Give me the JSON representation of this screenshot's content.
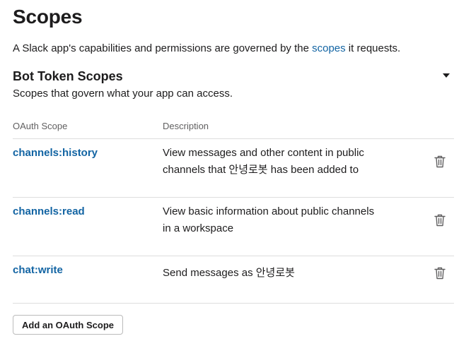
{
  "page": {
    "title": "Scopes",
    "intro_prefix": "A Slack app's capabilities and permissions are governed by the ",
    "intro_link": "scopes",
    "intro_suffix": " it requests."
  },
  "bot_section": {
    "title": "Bot Token Scopes",
    "subtitle": "Scopes that govern what your app can access.",
    "columns": {
      "scope": "OAuth Scope",
      "description": "Description"
    },
    "rows": [
      {
        "scope": "channels:history",
        "description_line1": "View messages and other content in public",
        "description_line2": "channels that 안녕로봇 has been added to"
      },
      {
        "scope": "channels:read",
        "description_line1": "View basic information about public channels",
        "description_line2": "in a workspace"
      },
      {
        "scope": "chat:write",
        "description_line1": "Send messages as 안녕로봇",
        "description_line2": ""
      }
    ],
    "add_button": "Add an OAuth Scope"
  },
  "icons": {
    "row_action": "trash-icon",
    "collapse": "caret-down-icon"
  },
  "colors": {
    "link": "#1264a3",
    "text": "#1d1c1d",
    "muted": "#616061",
    "divider": "#dddddd"
  }
}
